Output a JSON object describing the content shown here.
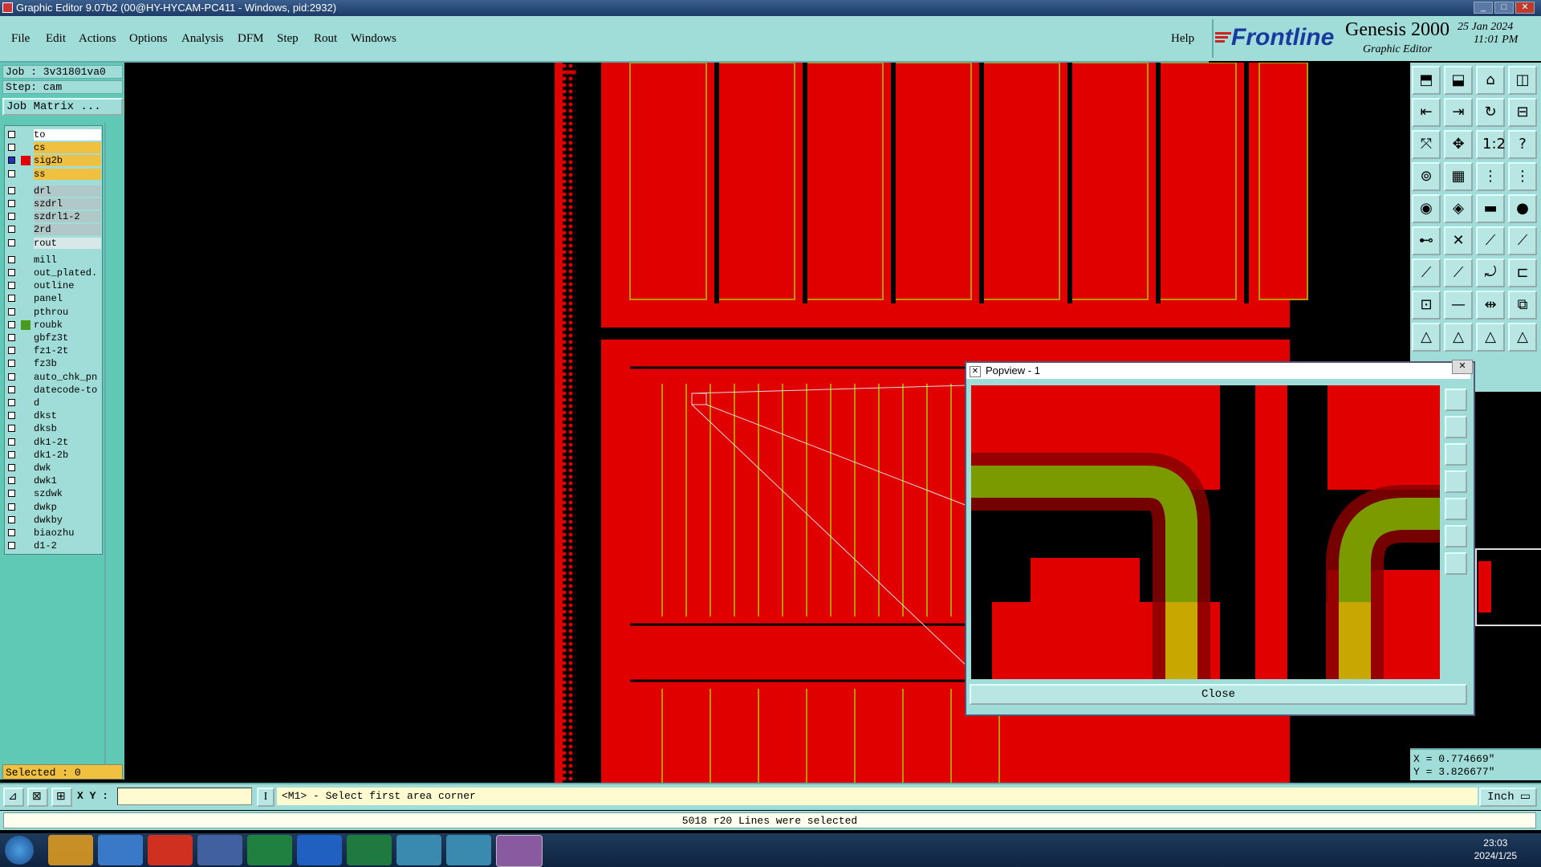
{
  "window": {
    "title": "Graphic Editor 9.07b2 (00@HY-HYCAM-PC411 - Windows, pid:2932)"
  },
  "menu": [
    "File",
    "Edit",
    "Actions",
    "Options",
    "Analysis",
    "DFM",
    "Step",
    "Rout",
    "Windows"
  ],
  "help_label": "Help",
  "brand": {
    "logo": "Frontline",
    "product": "Genesis 2000",
    "subtitle": "Graphic Editor",
    "date": "25 Jan 2024",
    "time": "11:01 PM"
  },
  "job": {
    "job_label": "Job : 3v31801va0",
    "step_label": "Step: cam",
    "matrix_button": "Job Matrix ..."
  },
  "layers": [
    {
      "name": "to",
      "color": "#ffffff",
      "swatch": ""
    },
    {
      "name": "cs",
      "color": "#f0c040",
      "swatch": ""
    },
    {
      "name": "sig2b",
      "color": "#f0c040",
      "swatch": "#e00000",
      "checked": true
    },
    {
      "name": "ss",
      "color": "#f0c040",
      "swatch": ""
    },
    {
      "name": "drl",
      "color": "#b0c8c8",
      "swatch": ""
    },
    {
      "name": "szdrl",
      "color": "#b0c8c8",
      "swatch": ""
    },
    {
      "name": "szdrl1-2",
      "color": "#b0c8c8",
      "swatch": ""
    },
    {
      "name": "2rd",
      "color": "#b0c8c8",
      "swatch": ""
    },
    {
      "name": "rout",
      "color": "#d8e8e8",
      "swatch": ""
    },
    {
      "name": "mill",
      "color": "#a0dcd8",
      "swatch": ""
    },
    {
      "name": "out_plated.",
      "color": "#a0dcd8",
      "swatch": ""
    },
    {
      "name": "outline",
      "color": "#a0dcd8",
      "swatch": ""
    },
    {
      "name": "panel",
      "color": "#a0dcd8",
      "swatch": ""
    },
    {
      "name": "pthrou",
      "color": "#a0dcd8",
      "swatch": ""
    },
    {
      "name": "roubk",
      "color": "#a0dcd8",
      "swatch": "#4a9a20"
    },
    {
      "name": "gbfz3t",
      "color": "#a0dcd8",
      "swatch": ""
    },
    {
      "name": "fz1-2t",
      "color": "#a0dcd8",
      "swatch": ""
    },
    {
      "name": "fz3b",
      "color": "#a0dcd8",
      "swatch": ""
    },
    {
      "name": "auto_chk_pn",
      "color": "#a0dcd8",
      "swatch": ""
    },
    {
      "name": "datecode-to",
      "color": "#a0dcd8",
      "swatch": ""
    },
    {
      "name": "d",
      "color": "#a0dcd8",
      "swatch": ""
    },
    {
      "name": "dkst",
      "color": "#a0dcd8",
      "swatch": ""
    },
    {
      "name": "dksb",
      "color": "#a0dcd8",
      "swatch": ""
    },
    {
      "name": "dk1-2t",
      "color": "#a0dcd8",
      "swatch": ""
    },
    {
      "name": "dk1-2b",
      "color": "#a0dcd8",
      "swatch": ""
    },
    {
      "name": "dwk",
      "color": "#a0dcd8",
      "swatch": ""
    },
    {
      "name": "dwk1",
      "color": "#a0dcd8",
      "swatch": ""
    },
    {
      "name": "szdwk",
      "color": "#a0dcd8",
      "swatch": ""
    },
    {
      "name": "dwkp",
      "color": "#a0dcd8",
      "swatch": ""
    },
    {
      "name": "dwkby",
      "color": "#a0dcd8",
      "swatch": ""
    },
    {
      "name": "biaozhu",
      "color": "#a0dcd8",
      "swatch": ""
    },
    {
      "name": "d1-2",
      "color": "#a0dcd8",
      "swatch": ""
    }
  ],
  "selected_label": "Selected : 0",
  "coordinates": {
    "x": "X = 0.774669\"",
    "y": "Y = 3.826677\""
  },
  "command": {
    "xy_label": "X Y :",
    "xy_value": "",
    "prompt": "<M1> - Select first area corner",
    "unit": "Inch"
  },
  "status": "5018 r20 Lines were selected",
  "popview": {
    "title": "Popview - 1",
    "close_label": "Close"
  },
  "taskbar": {
    "time": "23:03",
    "date": "2024/1/25"
  }
}
